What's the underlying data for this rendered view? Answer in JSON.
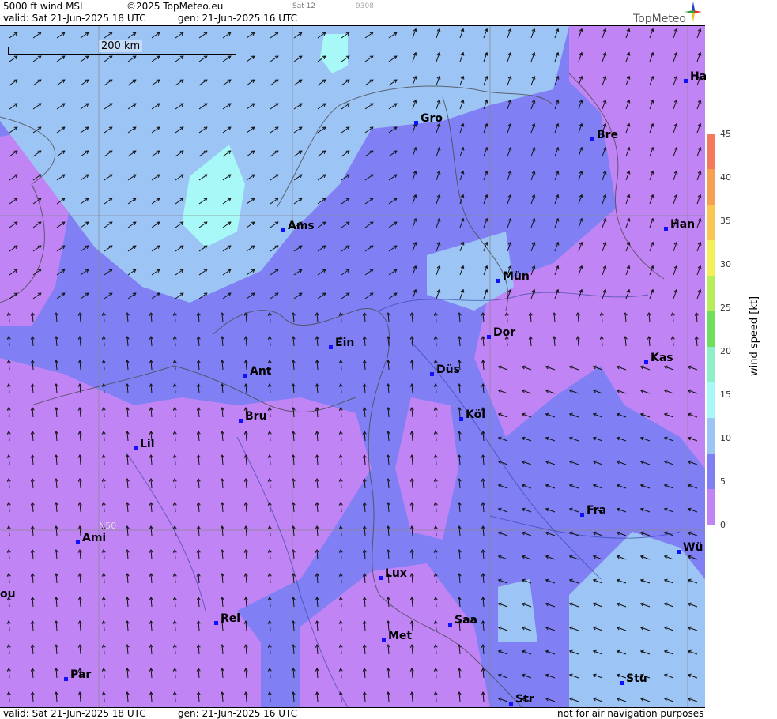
{
  "header": {
    "product": "5000 ft wind MSL",
    "copyright": "©2025 TopMeteo.eu",
    "day_tag": "Sat 12",
    "code": "9308",
    "valid": "valid:  Sat  21-Jun-2025  18 UTC",
    "gen": "gen: 21-Jun-2025 16 UTC",
    "logo": "TopMeteo"
  },
  "footer": {
    "valid": "valid:  Sat  21-Jun-2025  18 UTC",
    "gen": "gen: 21-Jun-2025 16 UTC",
    "note": "not for air navigation purposes"
  },
  "scale": {
    "label": "200 km"
  },
  "grid_label": "N50",
  "cities": [
    {
      "name": "Ha"
    },
    {
      "name": "Gro"
    },
    {
      "name": "Bre"
    },
    {
      "name": "Ams"
    },
    {
      "name": "Han"
    },
    {
      "name": "Mün"
    },
    {
      "name": "Dor"
    },
    {
      "name": "Ein"
    },
    {
      "name": "Kas"
    },
    {
      "name": "Ant"
    },
    {
      "name": "Düs"
    },
    {
      "name": "Bru"
    },
    {
      "name": "Köl"
    },
    {
      "name": "Lil"
    },
    {
      "name": "Fra"
    },
    {
      "name": "Ami"
    },
    {
      "name": "Wü"
    },
    {
      "name": "Lux"
    },
    {
      "name": "ou"
    },
    {
      "name": "Rei"
    },
    {
      "name": "Saa"
    },
    {
      "name": "Met"
    },
    {
      "name": "Stu"
    },
    {
      "name": "Par"
    },
    {
      "name": "Str"
    }
  ],
  "legend": {
    "title": "wind  speed  [kt]",
    "ticks": [
      "45",
      "40",
      "35",
      "30",
      "25",
      "20",
      "15",
      "10",
      "5",
      "0"
    ],
    "colors": [
      "#f47a5a",
      "#f7a054",
      "#fbc753",
      "#f4f05a",
      "#b8ec5a",
      "#6ee05e",
      "#8ef0c8",
      "#a8f8f8",
      "#9cc4f4",
      "#8080f4",
      "#c084f4"
    ]
  }
}
